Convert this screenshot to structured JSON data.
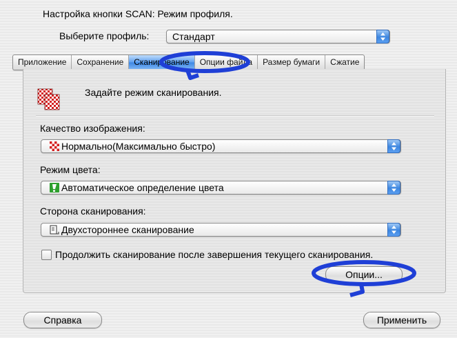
{
  "header": {
    "title": "Настройка кнопки SCAN: Режим профиля.",
    "profile_label": "Выберите профиль:",
    "profile_value": "Стандарт"
  },
  "tabs": [
    {
      "label": "Приложение",
      "active": false
    },
    {
      "label": "Сохранение",
      "active": false
    },
    {
      "label": "Сканирование",
      "active": true
    },
    {
      "label": "Опции файла",
      "active": false
    },
    {
      "label": "Размер бумаги",
      "active": false
    },
    {
      "label": "Сжатие",
      "active": false
    }
  ],
  "panel": {
    "description": "Задайте режим сканирования.",
    "quality_label": "Качество изображения:",
    "quality_value": "Нормально(Максимально быстро)",
    "color_label": "Режим цвета:",
    "color_value": "Автоматическое определение цвета",
    "side_label": "Сторона сканирования:",
    "side_value": "Двухстороннее сканирование",
    "continue_label": "Продолжить сканирование после завершения текущего сканирования.",
    "continue_checked": false,
    "options_button": "Опции..."
  },
  "footer": {
    "help_button": "Справка",
    "apply_button": "Применить"
  },
  "colors": {
    "accent_blue": "#3d87e4",
    "annotation_blue": "#1f3fd6",
    "icon_red": "#d42020",
    "icon_green": "#2ea02e"
  },
  "icons": {
    "scan_mode": "checker-pages-icon",
    "quality": "checker-icon",
    "color": "exclamation-green-icon",
    "side": "duplex-page-icon",
    "popup_arrow": "up-down-arrows-icon"
  }
}
